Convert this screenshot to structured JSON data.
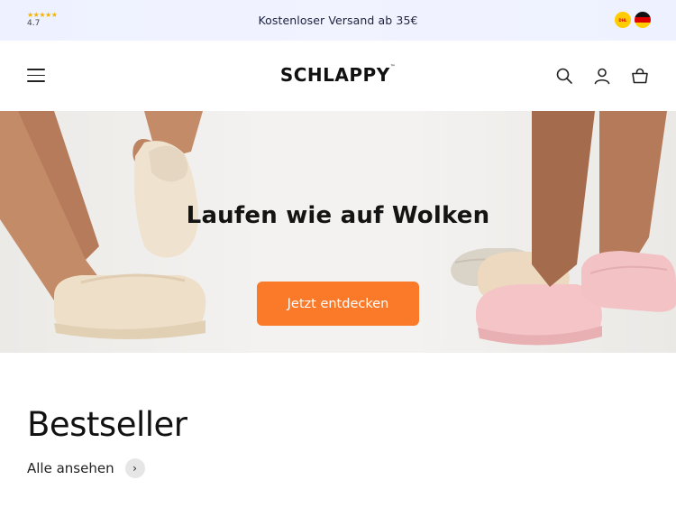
{
  "announcement": {
    "rating_stars": "★★★★★",
    "rating_value": "4.7",
    "text": "Kostenloser Versand ab 35€",
    "dhl_badge": "DHL"
  },
  "header": {
    "logo": "SCHLAPPY",
    "logo_mark": "™",
    "icons": [
      "menu-icon",
      "search-icon",
      "account-icon",
      "cart-icon"
    ]
  },
  "hero": {
    "headline": "Laufen wie auf Wolken",
    "cta_label": "Jetzt entdecken",
    "cta_color": "#fb7a29"
  },
  "bestseller": {
    "title": "Bestseller",
    "see_all_label": "Alle ansehen",
    "see_all_arrow": "›"
  }
}
